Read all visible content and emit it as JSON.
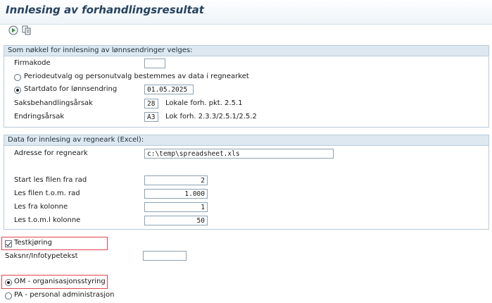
{
  "window": {
    "title": "Innlesing av forhandlingsresultat"
  },
  "toolbar": {
    "execute_icon": "execute-icon",
    "variant_icon": "get-variant-icon"
  },
  "group_key": {
    "title": "Som nøkkel for innlesning av lønnsendringer velges:",
    "firmakode_label": "Firmakode",
    "firmakode_value": "",
    "radio_period_label": "Periodeutvalg og personutvalg bestemmes av data i regnearket",
    "radio_period_selected": false,
    "radio_startdate_label": "Startdato for lønnsendring",
    "radio_startdate_selected": true,
    "startdate_value": "01.05.2025",
    "saks_label": "Saksbehandlingsårsak",
    "saks_value": "28",
    "saks_desc": "Lokale forh. pkt. 2.5.1",
    "endr_label": "Endringsårsak",
    "endr_value": "A3",
    "endr_desc": "Lok forh. 2.3.3/2.5.1/2.5.2"
  },
  "group_excel": {
    "title": "Data for innlesing av regneark (Excel):",
    "address_label": "Adresse for regneark",
    "address_value": "c:\\temp\\spreadsheet.xls",
    "start_row_label": "Start les filen fra rad",
    "start_row_value": "2",
    "end_row_label": "Les filen t.o.m. rad",
    "end_row_value": "1.000",
    "from_col_label": "Les fra kolonne",
    "from_col_value": "1",
    "to_col_label": "Les t.o.m.l kolonne",
    "to_col_value": "50"
  },
  "options": {
    "testrun_label": "Testkjøring",
    "testrun_checked": true,
    "saksnr_label": "Saksnr/Infotypetekst",
    "saksnr_value": "",
    "om_label": "OM - organisasjonsstyring",
    "om_selected": true,
    "pa_label": "PA - personal administrasjon",
    "pa_selected": false
  },
  "colors": {
    "highlight": "#e0454d",
    "title": "#26435f",
    "group_header": "#dde8f1"
  }
}
